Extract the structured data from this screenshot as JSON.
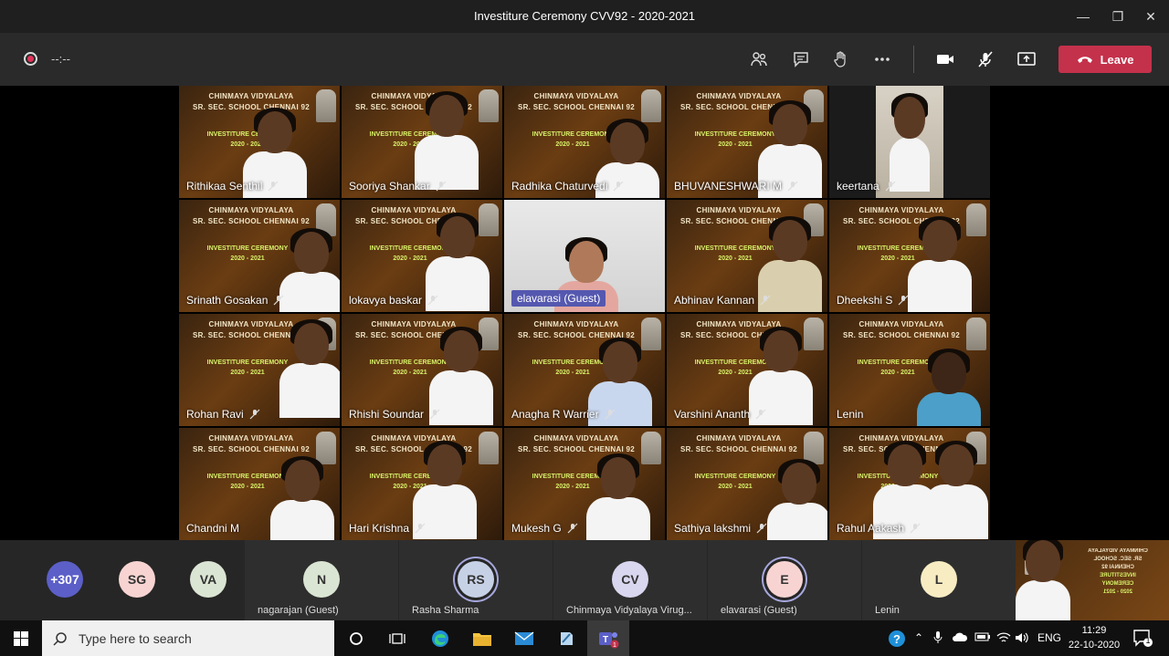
{
  "window": {
    "title": "Investiture Ceremony CVV92 - 2020-2021"
  },
  "toolbar": {
    "timer": "--:--",
    "leave_label": "Leave"
  },
  "banner": {
    "line1": "CHINMAYA VIDYALAYA",
    "line2": "SR. SEC. SCHOOL CHENNAI 92",
    "event1": "INVESTITURE CEREMONY",
    "event2": "2020 - 2021"
  },
  "tiles": [
    {
      "name": "Rithikaa Senthil"
    },
    {
      "name": "Sooriya Shankar"
    },
    {
      "name": "Radhika Chaturvedi"
    },
    {
      "name": "BHUVANESHWARI M"
    },
    {
      "name": "keertana"
    },
    {
      "name": "Srinath Gosakan"
    },
    {
      "name": "lokavya baskar"
    },
    {
      "name": "elavarasi (Guest)"
    },
    {
      "name": "Abhinav Kannan"
    },
    {
      "name": "Dheekshi S"
    },
    {
      "name": "Rohan Ravi"
    },
    {
      "name": "Rhishi Soundar"
    },
    {
      "name": "Anagha R Warrier"
    },
    {
      "name": "Varshini Ananth"
    },
    {
      "name": "Lenin"
    },
    {
      "name": "Chandni M"
    },
    {
      "name": "Hari Krishna"
    },
    {
      "name": "Mukesh G"
    },
    {
      "name": "Sathiya lakshmi"
    },
    {
      "name": "Rahul Aakash"
    }
  ],
  "participants_bar": {
    "overflow": "+307",
    "initials": [
      {
        "initials": "SG",
        "color": "#f7d4d2"
      },
      {
        "initials": "VA",
        "color": "#dbe5d3"
      }
    ],
    "slots": [
      {
        "initials": "N",
        "label": "nagarajan (Guest)",
        "color": "#dbe5d3"
      },
      {
        "initials": "RS",
        "label": "Rasha Sharma",
        "color": "#c7d1e6"
      },
      {
        "initials": "CV",
        "label": "Chinmaya Vidyalaya Virug...",
        "color": "#d9d6ef"
      },
      {
        "initials": "E",
        "label": "elavarasi (Guest)",
        "color": "#f7d4d2"
      },
      {
        "initials": "L",
        "label": "Lenin",
        "color": "#f8ecc3"
      }
    ]
  },
  "taskbar": {
    "search_placeholder": "Type here to search",
    "lang": "ENG",
    "time": "11:29",
    "date": "22-10-2020",
    "notif_count": "1"
  },
  "colors": {
    "accent": "#5558af",
    "leave": "#c4314b",
    "toolbar": "#2a2a2a"
  }
}
